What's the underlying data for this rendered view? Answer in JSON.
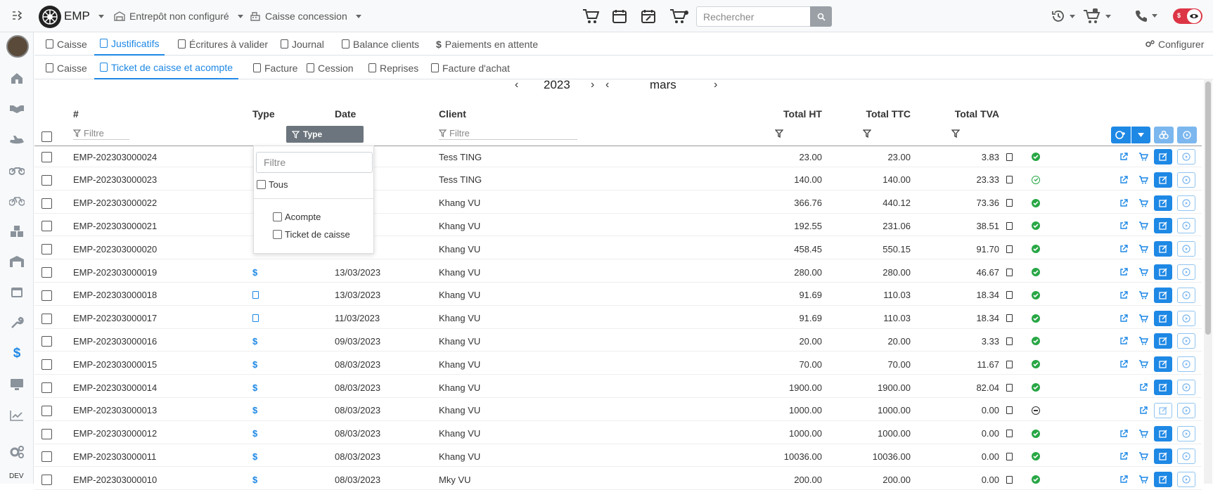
{
  "topbar": {
    "brand": "EMP",
    "warehouse": "Entrepôt non configuré",
    "register": "Caisse concession",
    "search_placeholder": "Rechercher"
  },
  "sidebar": {
    "env_label": "DEV",
    "items": [
      "home-icon",
      "handshake-icon",
      "jetski-icon",
      "motorbike-icon",
      "bicycle-icon",
      "boxes-icon",
      "warehouse-icon",
      "calendar-icon",
      "wrench-icon",
      "dollar-icon",
      "monitor-icon",
      "chart-icon",
      "settings-icon"
    ]
  },
  "tabs_main": [
    {
      "label": "Caisse",
      "active": false
    },
    {
      "label": "Justificatifs",
      "active": true
    },
    {
      "label": "Écritures à valider",
      "active": false
    },
    {
      "label": "Journal",
      "active": false
    },
    {
      "label": "Balance clients",
      "active": false
    },
    {
      "label": "Paiements en attente",
      "active": false
    }
  ],
  "configure_label": "Configurer",
  "tabs_sub": [
    {
      "label": "Caisse",
      "active": false
    },
    {
      "label": "Ticket de caisse et acompte",
      "active": true
    },
    {
      "label": "Facture",
      "active": false
    },
    {
      "label": "Cession",
      "active": false
    },
    {
      "label": "Reprises",
      "active": false
    },
    {
      "label": "Facture d'achat",
      "active": false
    }
  ],
  "period": {
    "year": "2023",
    "month": "mars"
  },
  "columns": {
    "number": "#",
    "type": "Type",
    "date": "Date",
    "client": "Client",
    "total_ht": "Total HT",
    "total_ttc": "Total TTC",
    "total_tva": "Total TVA"
  },
  "filters": {
    "number_placeholder": "Filtre",
    "type_button": "Type",
    "client_placeholder": "Filtre"
  },
  "type_popup": {
    "search_placeholder": "Filtre",
    "all_label": "Tous",
    "options": [
      "Acompte",
      "Ticket de caisse"
    ]
  },
  "rows": [
    {
      "id": "EMP-202303000024",
      "type": "",
      "date": "",
      "client": "Tess TING",
      "ht": "23.00",
      "ttc": "23.00",
      "tva": "3.83",
      "status": "ok",
      "actions": "full"
    },
    {
      "id": "EMP-202303000023",
      "type": "",
      "date": "",
      "client": "Tess TING",
      "ht": "140.00",
      "ttc": "140.00",
      "tva": "23.33",
      "status": "ok-outline",
      "actions": "full"
    },
    {
      "id": "EMP-202303000022",
      "type": "",
      "date": "",
      "client": "Khang VU",
      "ht": "366.76",
      "ttc": "440.12",
      "tva": "73.36",
      "status": "ok",
      "actions": "full"
    },
    {
      "id": "EMP-202303000021",
      "type": "",
      "date": "",
      "client": "Khang VU",
      "ht": "192.55",
      "ttc": "231.06",
      "tva": "38.51",
      "status": "ok",
      "actions": "full"
    },
    {
      "id": "EMP-202303000020",
      "type": "",
      "date": "",
      "client": "Khang VU",
      "ht": "458.45",
      "ttc": "550.15",
      "tva": "91.70",
      "status": "ok",
      "actions": "full"
    },
    {
      "id": "EMP-202303000019",
      "type": "$",
      "date": "13/03/2023",
      "client": "Khang VU",
      "ht": "280.00",
      "ttc": "280.00",
      "tva": "46.67",
      "status": "ok",
      "actions": "full"
    },
    {
      "id": "EMP-202303000018",
      "type": "doc",
      "date": "13/03/2023",
      "client": "Khang VU",
      "ht": "91.69",
      "ttc": "110.03",
      "tva": "18.34",
      "status": "ok",
      "actions": "full"
    },
    {
      "id": "EMP-202303000017",
      "type": "doc",
      "date": "11/03/2023",
      "client": "Khang VU",
      "ht": "91.69",
      "ttc": "110.03",
      "tva": "18.34",
      "status": "ok",
      "actions": "full"
    },
    {
      "id": "EMP-202303000016",
      "type": "$",
      "date": "09/03/2023",
      "client": "Khang VU",
      "ht": "20.00",
      "ttc": "20.00",
      "tva": "3.33",
      "status": "ok",
      "actions": "full"
    },
    {
      "id": "EMP-202303000015",
      "type": "$",
      "date": "08/03/2023",
      "client": "Khang VU",
      "ht": "70.00",
      "ttc": "70.00",
      "tva": "11.67",
      "status": "ok",
      "actions": "full"
    },
    {
      "id": "EMP-202303000014",
      "type": "$",
      "date": "08/03/2023",
      "client": "Khang VU",
      "ht": "1900.00",
      "ttc": "1900.00",
      "tva": "82.04",
      "status": "ok",
      "actions": "short"
    },
    {
      "id": "EMP-202303000013",
      "type": "$",
      "date": "08/03/2023",
      "client": "Khang VU",
      "ht": "1000.00",
      "ttc": "1000.00",
      "tva": "0.00",
      "status": "neutral",
      "actions": "disabled"
    },
    {
      "id": "EMP-202303000012",
      "type": "$",
      "date": "08/03/2023",
      "client": "Khang VU",
      "ht": "1000.00",
      "ttc": "1000.00",
      "tva": "0.00",
      "status": "ok",
      "actions": "full"
    },
    {
      "id": "EMP-202303000011",
      "type": "$",
      "date": "08/03/2023",
      "client": "Khang VU",
      "ht": "10036.00",
      "ttc": "10036.00",
      "tva": "0.00",
      "status": "ok",
      "actions": "full"
    },
    {
      "id": "EMP-202303000010",
      "type": "$",
      "date": "08/03/2023",
      "client": "Mky VU",
      "ht": "200.00",
      "ttc": "200.00",
      "tva": "0.00",
      "status": "ok",
      "actions": "full"
    }
  ],
  "colors": {
    "accent": "#1e88e5",
    "success": "#28a745",
    "muted": "#6c757d"
  }
}
